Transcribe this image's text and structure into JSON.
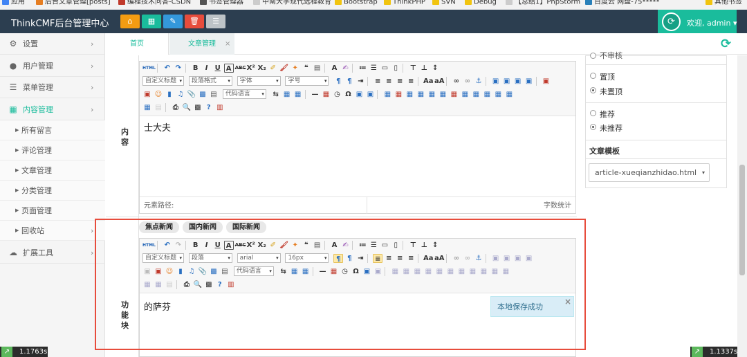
{
  "bookmarks": [
    {
      "label": "应用",
      "color": "#4285f4"
    },
    {
      "label": "后台文章管理[posts]",
      "color": "#e67e22"
    },
    {
      "label": "编程技术问答-CSDN",
      "color": "#c0392b"
    },
    {
      "label": "书签管理器",
      "color": "#555555"
    },
    {
      "label": "中南大学现代远程教育",
      "color": "#888888"
    },
    {
      "label": "Bootstrap",
      "color": "#f1c40f"
    },
    {
      "label": "ThinkPHP",
      "color": "#f1c40f"
    },
    {
      "label": "SVN",
      "color": "#f1c40f"
    },
    {
      "label": "Debug",
      "color": "#f1c40f"
    },
    {
      "label": "【总结1】PhpStorm",
      "color": "#888888"
    },
    {
      "label": "百度云 网盘-75*****",
      "color": "#2980b9"
    },
    {
      "label": "其他书签",
      "color": "#f1c40f"
    }
  ],
  "header": {
    "brand": "ThinkCMF后台管理中心",
    "buttons": [
      {
        "icon": "home-icon",
        "glyph": "⌂",
        "color": "#f39c12"
      },
      {
        "icon": "grid-icon",
        "glyph": "▦",
        "color": "#1abc9c"
      },
      {
        "icon": "pencil-icon",
        "glyph": "✎",
        "color": "#3498db"
      },
      {
        "icon": "trash-icon",
        "glyph": "🗑",
        "color": "#e74c3c"
      },
      {
        "icon": "list-icon",
        "glyph": "☰",
        "color": "#bdc3c7"
      }
    ],
    "user_label": "欢迎, admin ▾"
  },
  "sidebar": {
    "items": [
      {
        "icon": "gear-icon",
        "glyph": "⚙",
        "label": "设置"
      },
      {
        "icon": "users-icon",
        "glyph": "👥",
        "label": "用户管理"
      },
      {
        "icon": "menu-icon",
        "glyph": "☰",
        "label": "菜单管理"
      },
      {
        "icon": "content-icon",
        "glyph": "▦",
        "label": "内容管理"
      }
    ],
    "sub_items": [
      "所有留言",
      "评论管理",
      "文章管理",
      "分类管理",
      "页面管理",
      "回收站"
    ],
    "last_item": {
      "icon": "cloud-icon",
      "glyph": "☁",
      "label": "扩展工具"
    }
  },
  "tabs": {
    "home": "首页",
    "article": "文章管理",
    "close": "×"
  },
  "form": {
    "content_label": "内容",
    "block_label": "功能块",
    "editor1_text": "士大夫",
    "editor1_path": "元素路径:",
    "editor1_count": "字数统计",
    "editor2_text": "的萨芬",
    "block_tabs": [
      "焦点新闻",
      "国内新闻",
      "国际新闻"
    ]
  },
  "toolbar": {
    "html": "HTML",
    "custom_title": "自定义标题",
    "paragraph_format": "段落格式",
    "font": "字体",
    "size": "字号",
    "code_lang": "代码语言",
    "paragraph": "段落",
    "font2": "arial",
    "size2": "16px"
  },
  "rpanel": {
    "top_partial": "不审核",
    "top_options": [
      "置顶",
      "未置顶"
    ],
    "recommend_options": [
      "推荐",
      "未推荐"
    ],
    "template_label": "文章模板",
    "template_value": "article-xueqianzhidao.html"
  },
  "toast": {
    "text": "本地保存成功",
    "close": "×"
  },
  "timers": {
    "left": "1.1763s",
    "right": "1.1337s"
  }
}
